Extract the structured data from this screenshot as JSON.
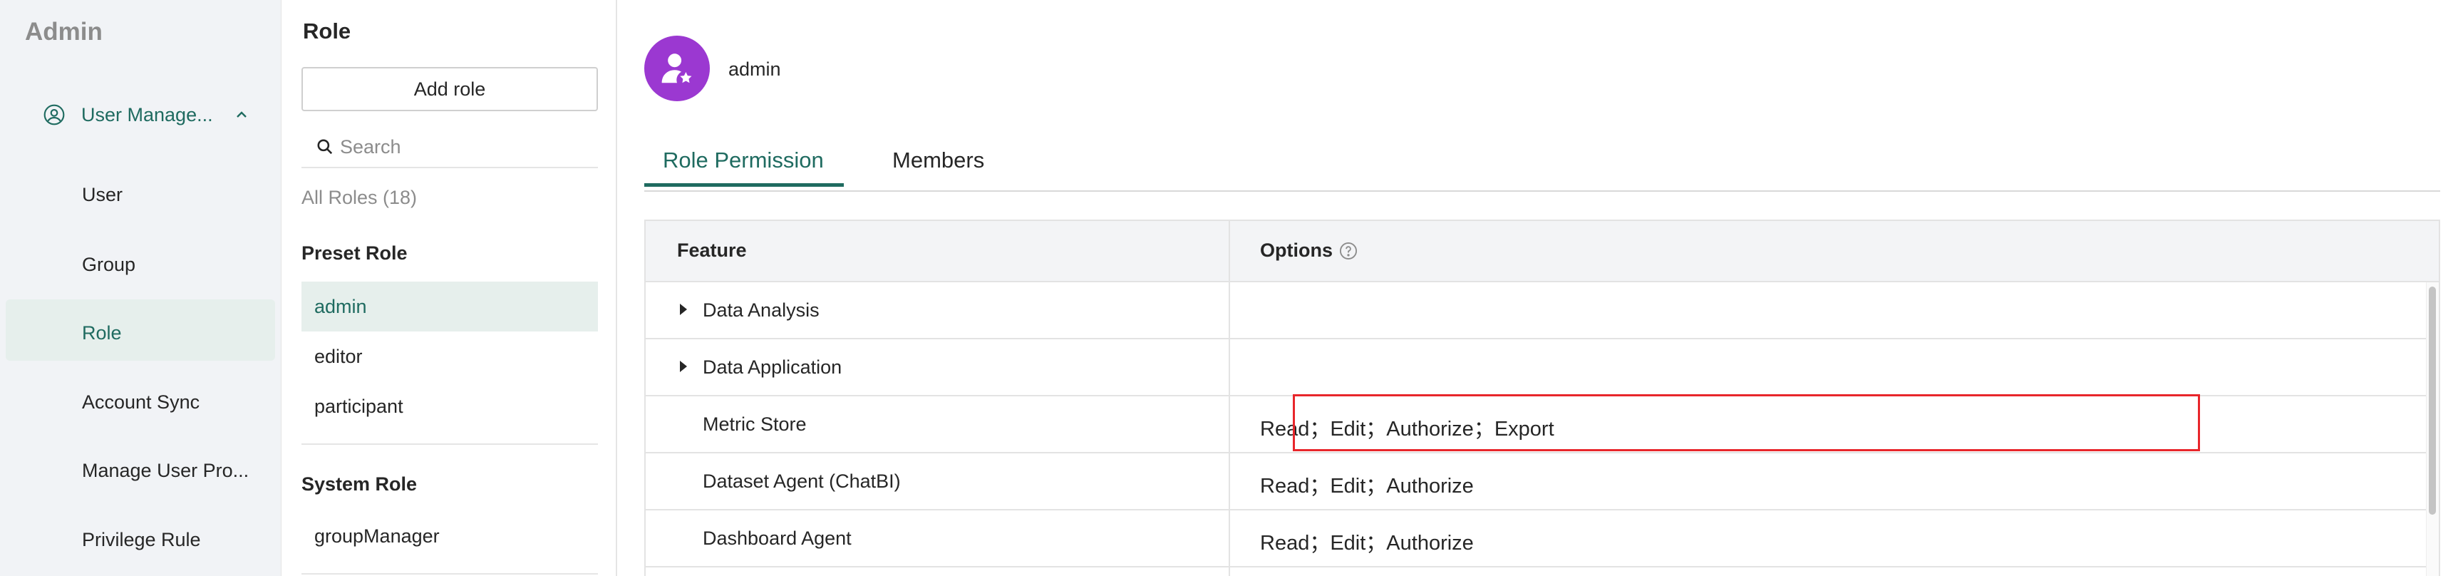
{
  "nav": {
    "title": "Admin",
    "group_label": "User Manage...",
    "items": [
      {
        "label": "User"
      },
      {
        "label": "Group"
      },
      {
        "label": "Role"
      },
      {
        "label": "Account Sync"
      },
      {
        "label": "Manage User Pro..."
      },
      {
        "label": "Privilege Rule"
      }
    ],
    "active_item": "Role"
  },
  "roles": {
    "title": "Role",
    "add_label": "Add role",
    "search_placeholder": "Search",
    "all_roles": "All Roles (18)",
    "preset_heading": "Preset Role",
    "preset": [
      {
        "label": "admin"
      },
      {
        "label": "editor"
      },
      {
        "label": "participant"
      }
    ],
    "system_heading": "System Role",
    "system": [
      {
        "label": "groupManager"
      }
    ]
  },
  "main": {
    "role_name": "admin",
    "tabs": [
      {
        "label": "Role Permission"
      },
      {
        "label": "Members"
      }
    ],
    "active_tab": "Role Permission",
    "table": {
      "headers": {
        "feature": "Feature",
        "options": "Options"
      },
      "rows": [
        {
          "feature": "Data Analysis",
          "options": "",
          "expandable": true
        },
        {
          "feature": "Data Application",
          "options": "",
          "expandable": true
        },
        {
          "feature": "Metric Store",
          "options": "Read；Edit；Authorize；Export",
          "expandable": false
        },
        {
          "feature": "Dataset Agent (ChatBI)",
          "options": "Read；Edit；Authorize",
          "expandable": false
        },
        {
          "feature": "Dashboard Agent",
          "options": "Read；Edit；Authorize",
          "expandable": false
        }
      ]
    }
  },
  "colors": {
    "accent": "#1f6b60",
    "avatar": "#9b38d1",
    "highlight": "#e8262b",
    "nav_bg": "#f1f3f6"
  },
  "icons": [
    "user-circle-icon",
    "chevron-up-icon",
    "search-icon",
    "user-star-icon",
    "help-circle-icon",
    "caret-right-icon"
  ]
}
